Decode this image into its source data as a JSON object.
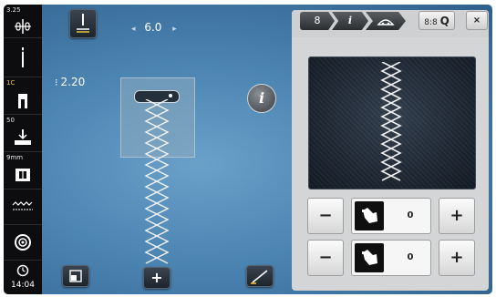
{
  "sidebar": {
    "thread_tension": {
      "value": "3.25",
      "icon": "thread-tension-icon"
    },
    "needle_position": {
      "icon": "needle-position-icon"
    },
    "presser_foot": {
      "value": "1C",
      "icon": "presser-foot-icon"
    },
    "foot_pressure": {
      "value": "50",
      "icon": "foot-pressure-icon"
    },
    "stitch_plate": {
      "value": "9mm",
      "icon": "stitch-plate-icon"
    },
    "feed_dog": {
      "icon": "feed-dog-icon"
    },
    "bobbin": {
      "icon": "bobbin-icon"
    },
    "clock": {
      "value": "14:04",
      "icon": "clock-icon"
    }
  },
  "stitch": {
    "width": "6.0",
    "length": "2.20",
    "info_symbol": "i"
  },
  "bottom_buttons": {
    "left_icon": "pattern-end-icon",
    "plus_label": "+",
    "right_icon": "stitch-edit-icon"
  },
  "right_panel": {
    "tabs": [
      {
        "label": "8"
      },
      {
        "label": "i"
      },
      {
        "label": "presser-foot-icon"
      }
    ],
    "zoom": {
      "label": "8:8",
      "symbol": "Q"
    },
    "close_label": "×",
    "controls": [
      {
        "minus": "−",
        "value": "0",
        "plus": "+"
      },
      {
        "minus": "−",
        "value": "0",
        "plus": "+"
      }
    ]
  }
}
